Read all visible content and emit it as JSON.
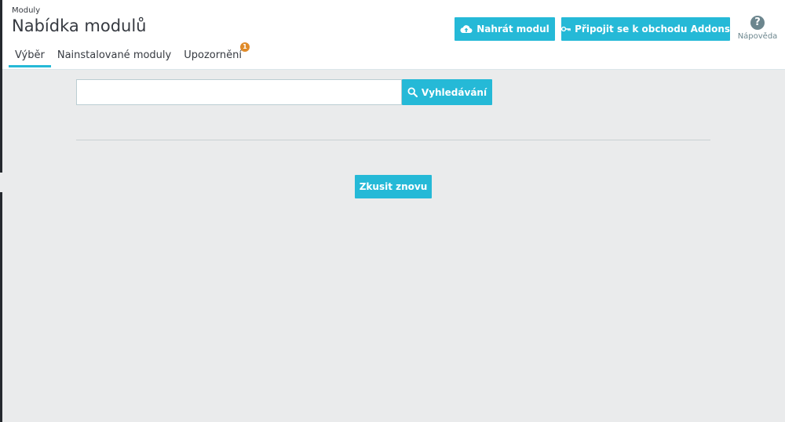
{
  "header": {
    "breadcrumb": "Moduly",
    "title": "Nabídka modulů"
  },
  "tabs": [
    {
      "label": "Výběr",
      "active": true
    },
    {
      "label": "Nainstalované moduly",
      "active": false
    },
    {
      "label": "Upozornění",
      "active": false,
      "badge": "1"
    }
  ],
  "toolbar": {
    "upload_label": "Nahrát modul",
    "upload_icon": "cloud-upload-icon",
    "connect_label": "Připojit se k obchodu Addons",
    "connect_icon": "key-icon",
    "help_label": "Nápověda",
    "help_icon": "question-circle-icon"
  },
  "search": {
    "value": "",
    "placeholder": "",
    "button_label": "Vyhledávání",
    "button_icon": "search-icon"
  },
  "retry": {
    "label": "Zkusit znovu"
  },
  "colors": {
    "accent": "#25b9d7",
    "background": "#eaebec",
    "badge": "#e08b2a"
  }
}
